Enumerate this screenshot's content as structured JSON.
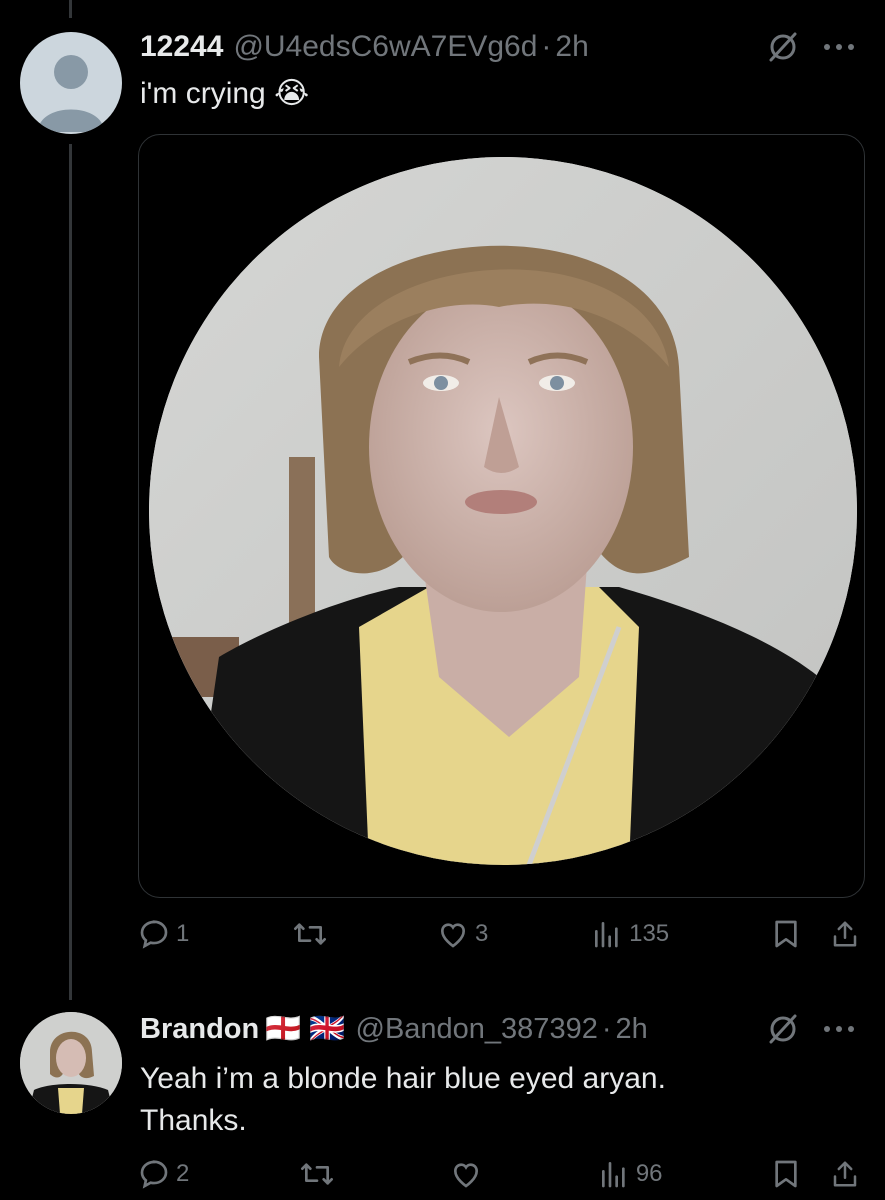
{
  "tweet1": {
    "display_name": "12244",
    "handle": "@U4edsC6wA7EVg6d",
    "separator": "·",
    "time": "2h",
    "text": "i'm crying",
    "emoji": "😭",
    "stats": {
      "replies": "1",
      "retweets": "",
      "likes": "3",
      "views": "135"
    }
  },
  "tweet2": {
    "display_name": "Brandon",
    "flags": "🏴󠁧󠁢󠁥󠁮󠁧󠁿 🇬🇧",
    "handle": "@Bandon_387392",
    "separator": "·",
    "time": "2h",
    "text_line1": "Yeah i’m a blonde hair blue eyed aryan.",
    "text_line2": "Thanks.",
    "stats": {
      "replies": "2",
      "retweets": "",
      "likes": "",
      "views": "96"
    }
  },
  "colors": {
    "background": "#000000",
    "text": "#e7e9ea",
    "muted": "#71767b",
    "border": "#2f3336"
  }
}
